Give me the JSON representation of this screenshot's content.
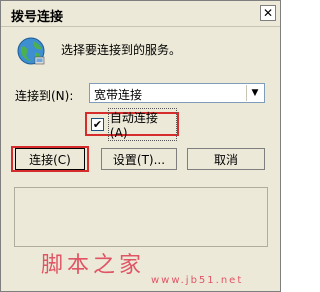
{
  "window": {
    "title": "拨号连接",
    "close_glyph": "✕"
  },
  "dialog": {
    "prompt": "选择要连接到的服务。",
    "connect_to_label": "连接到(N):",
    "connect_to_value": "宽带连接",
    "auto_connect_label": "自动连接(A)",
    "auto_connect_checked": true
  },
  "buttons": {
    "connect": "连接(C)",
    "settings": "设置(T)...",
    "cancel": "取消"
  },
  "watermark": {
    "cn": "脚本之家",
    "url": "www.jb51.net"
  },
  "icons": {
    "globe": "globe-network-icon"
  },
  "colors": {
    "highlight_red": "#d62c2c",
    "dialog_bg": "#ece9d8",
    "watermark": "#e05565"
  }
}
